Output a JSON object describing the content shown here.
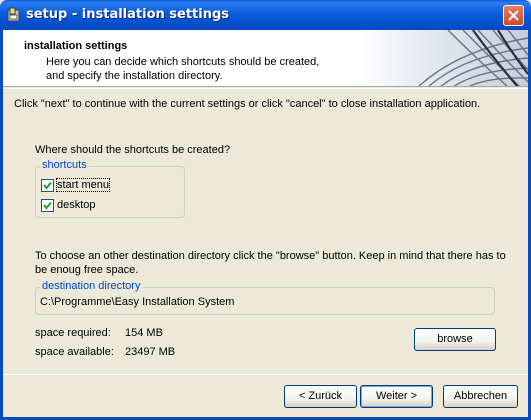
{
  "window": {
    "title": "setup - installation settings"
  },
  "header": {
    "heading": "installation settings",
    "desc_line1": "Here you can decide which shortcuts should be created,",
    "desc_line2": "and specify the installation directory."
  },
  "hint": "Click \"next\" to continue with the current settings or click \"cancel\" to close installation application.",
  "shortcuts": {
    "question": "Where should the shortcuts be created?",
    "group_label": "shortcuts",
    "items": [
      {
        "label": "start menu",
        "checked": true
      },
      {
        "label": "desktop",
        "checked": true
      }
    ]
  },
  "destination": {
    "info_line1": "To choose an other destination directory click the \"browse\" button. Keep in mind that there has to",
    "info_line2": "be enoug free space.",
    "group_label": "destination directory",
    "path": "C:\\Programme\\Easy Installation System",
    "space_required_label": "space required:",
    "space_required_value": "154 MB",
    "space_available_label": "space available:",
    "space_available_value": "23497 MB",
    "browse_label": "browse"
  },
  "footer": {
    "back_label": "< Zurück",
    "next_label": "Weiter >",
    "cancel_label": "Abbrechen"
  },
  "colors": {
    "titlebar": "#0a5bd8",
    "accent_legend": "#0046d5",
    "background": "#ece9d8"
  }
}
